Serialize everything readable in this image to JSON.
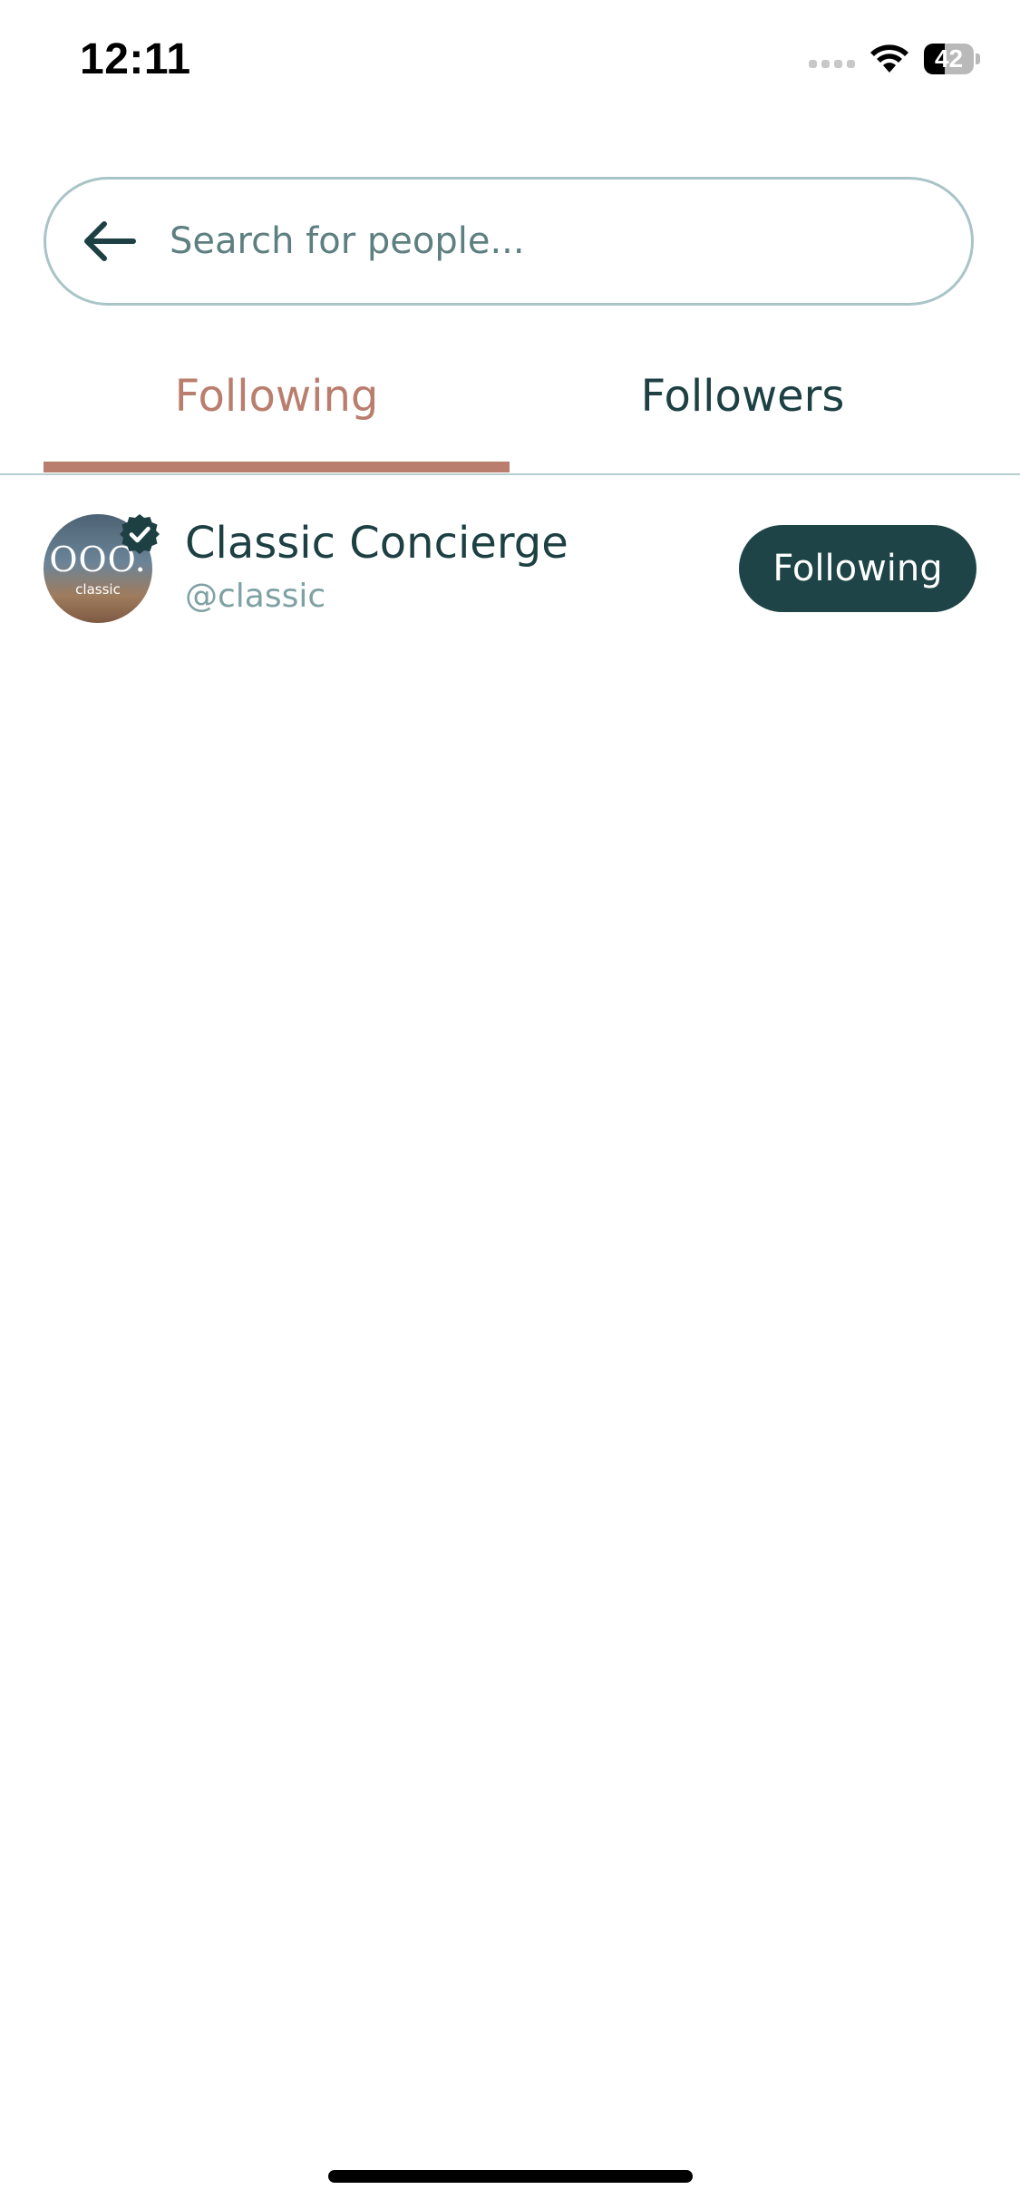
{
  "status_bar": {
    "time": "12:11",
    "battery_level": "42",
    "battery_fraction": 0.42
  },
  "search": {
    "placeholder": "Search for people...",
    "value": ""
  },
  "tabs": [
    {
      "label": "Following",
      "active": true
    },
    {
      "label": "Followers",
      "active": false
    }
  ],
  "list": {
    "items": [
      {
        "name": "Classic Concierge",
        "handle": "@classic",
        "verified": true,
        "avatar_text": "OOO.",
        "avatar_sub": "classic",
        "button_label": "Following"
      }
    ]
  },
  "colors": {
    "accent": "#b97e6d",
    "primary": "#1d4043",
    "button_bg": "#1f4447",
    "muted": "#7fa1a3",
    "border": "#a9c4c7"
  },
  "icons": {
    "back": "arrow-left-icon",
    "verified": "verified-badge-icon",
    "wifi": "wifi-icon",
    "signal": "cellular-signal-icon",
    "battery": "battery-icon"
  }
}
